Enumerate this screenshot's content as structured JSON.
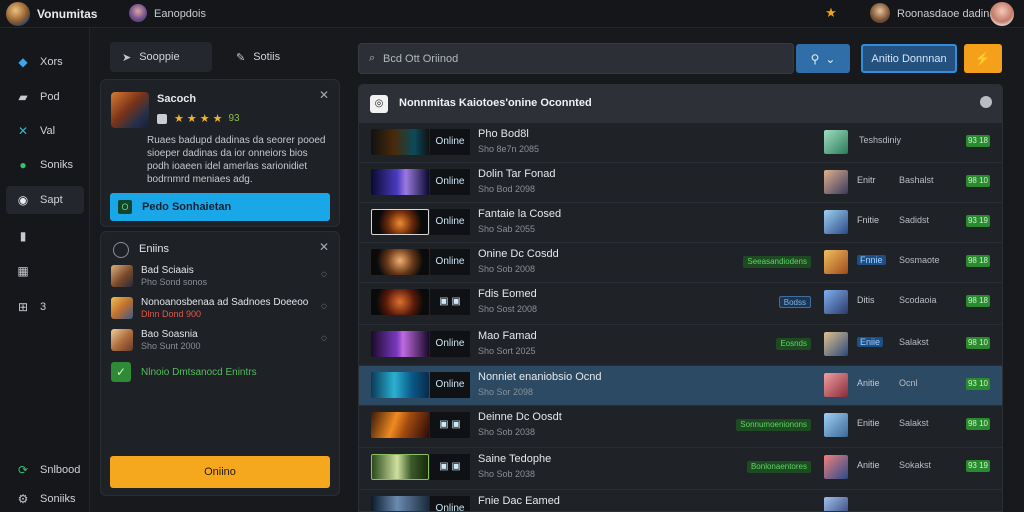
{
  "app": {
    "title": "Vonumitas",
    "user_name": "Eanopdois",
    "profile_name": "Roonasdaoe dadinas",
    "notification_icon": "star-icon"
  },
  "sidebar": {
    "items": [
      {
        "label": "Xors",
        "icon": "tag-icon",
        "color": "#3fa3f0"
      },
      {
        "label": "Pod",
        "icon": "message-icon",
        "color": "#c7cbd1"
      },
      {
        "label": "Val",
        "icon": "cross-icon",
        "color": "#38b6c9"
      },
      {
        "label": "Soniks",
        "icon": "chat-icon",
        "color": "#38c172"
      },
      {
        "label": "Sapt",
        "icon": "circle-icon",
        "color": "#e8eaee"
      },
      {
        "label": "",
        "icon": "bookmark-icon",
        "color": "#c7cbd1"
      },
      {
        "label": "",
        "icon": "store-icon",
        "color": "#c7cbd1"
      },
      {
        "label": "3",
        "icon": "grid-icon",
        "color": "#c7cbd1"
      }
    ],
    "bottom": [
      {
        "label": "Snlbood",
        "icon": "sync-icon",
        "color": "#38c172"
      },
      {
        "label": "Soniiks",
        "icon": "gear-icon",
        "color": "#c7cbd1"
      }
    ]
  },
  "left_tabs": [
    {
      "label": "Sooppie",
      "icon": "play-icon"
    },
    {
      "label": "Sotiis",
      "icon": "pencil-icon"
    }
  ],
  "featured": {
    "name": "Sacoch",
    "rating": "93",
    "stars": 4,
    "description": "Ruaes badupd dadinas da seorer pooed sioeper dadinas da ior onneiors bios podh ioaeen idel amerlas sarionidiet bodrnmrd meniaes adg.",
    "button_badge": "O",
    "button_label": "Pedo Sonhaietan"
  },
  "friends": {
    "title": "Eniins",
    "list": [
      {
        "name": "Bad Sciaais",
        "status": "Pho Sond sonos",
        "status_red": false
      },
      {
        "name": "Nonoanosbenaa ad Sadnoes Doeeoo",
        "status": "Dlnn Dond 900",
        "status_red": true
      },
      {
        "name": "Bao Soasnia",
        "status": "Sho Sunt 2000",
        "status_red": false
      }
    ],
    "add_label": "Nlnoio Dmtsanocd Enintrs",
    "action_label": "Oniino"
  },
  "search": {
    "placeholder": "Bcd Ott Oriinod",
    "dropdown_icon": "search-icon",
    "action_label": "Anitio Donnnan",
    "orange_icon": "bolt-icon"
  },
  "games": {
    "title": "Nonnmitas Kaiotoes'onine Oconnted",
    "rows": [
      {
        "status": "Online",
        "title": "Pho Bod8l",
        "sub": "Sho 8e7n 2085",
        "tag": "",
        "tag_style": "",
        "player_badge": "",
        "player_status": "Teshsdiniy",
        "price": "93 18"
      },
      {
        "status": "Online",
        "title": "Dolin Tar Fonad",
        "sub": "Sho Bod 2098",
        "tag": "",
        "tag_style": "",
        "player_badge": "Enitr",
        "player_status": "Bashalst",
        "price": "98 10"
      },
      {
        "status": "Online",
        "title": "Fantaie la Cosed",
        "sub": "Sho Sab 2055",
        "tag": "",
        "tag_style": "",
        "player_badge": "Fnitie",
        "player_status": "Sadidst",
        "price": "93 19"
      },
      {
        "status": "Online",
        "title": "Onine Dc Cosdd",
        "sub": "Sho Sob 2008",
        "tag": "Seeasandiodens",
        "tag_style": "green",
        "player_badge": "Fnnie",
        "player_status": "Sosmaote",
        "price": "98 18"
      },
      {
        "status": "",
        "title": "Fdis Eomed",
        "sub": "Sho Sost 2008",
        "tag": "Bodss",
        "tag_style": "blue",
        "player_badge": "Ditis",
        "player_status": "Scodaoia",
        "price": "98 18"
      },
      {
        "status": "Online",
        "title": "Mao Famad",
        "sub": "Sho Sort 2025",
        "tag": "Eosnds",
        "tag_style": "green",
        "player_badge": "Eniie",
        "player_status": "Salakst",
        "price": "98 10"
      },
      {
        "status": "Online",
        "title": "Nonniet enaniobsio Ocnd",
        "sub": "Sho Sor 2098",
        "tag": "",
        "tag_style": "",
        "player_badge": "Anitie",
        "player_status": "Ocnl",
        "price": "93 10"
      },
      {
        "status": "",
        "title": "Deinne Dc Oosdt",
        "sub": "Sho Sob 2038",
        "tag": "Sonnumoenionons",
        "tag_style": "green",
        "player_badge": "Enitie",
        "player_status": "Salakst",
        "price": "98 10"
      },
      {
        "status": "",
        "title": "Saine Tedophe",
        "sub": "Sho Sob 2038",
        "tag": "Bonlonaentores",
        "tag_style": "green",
        "player_badge": "Anitie",
        "player_status": "Sokakst",
        "price": "93 19"
      },
      {
        "status": "Online",
        "title": "Fnie Dac Eamed",
        "sub": "",
        "tag": "",
        "tag_style": "",
        "player_badge": "",
        "player_status": "",
        "price": ""
      }
    ]
  }
}
